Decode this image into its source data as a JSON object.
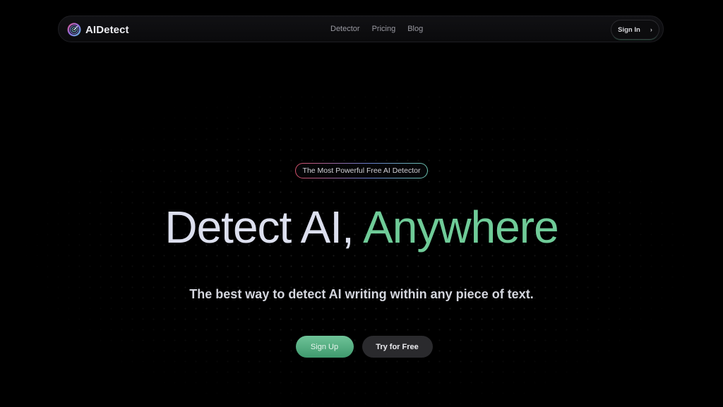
{
  "nav": {
    "brand": "AIDetect",
    "logo_icon": "radar-target-icon",
    "links": [
      "Detector",
      "Pricing",
      "Blog"
    ],
    "signin_label": "Sign In",
    "signin_icon": "chevron-right-icon"
  },
  "hero": {
    "badge": "The Most Powerful Free AI Detector",
    "headline_main": "Detect AI, ",
    "headline_accent": "Anywhere",
    "subheadline": "The best way to detect AI writing within any piece of text.",
    "primary_cta": "Sign Up",
    "secondary_cta": "Try for Free"
  },
  "colors": {
    "background": "#000000",
    "accent_green": "#6fcb98",
    "headline_text": "#dcdfee",
    "secondary_button": "#2a2a2d"
  }
}
